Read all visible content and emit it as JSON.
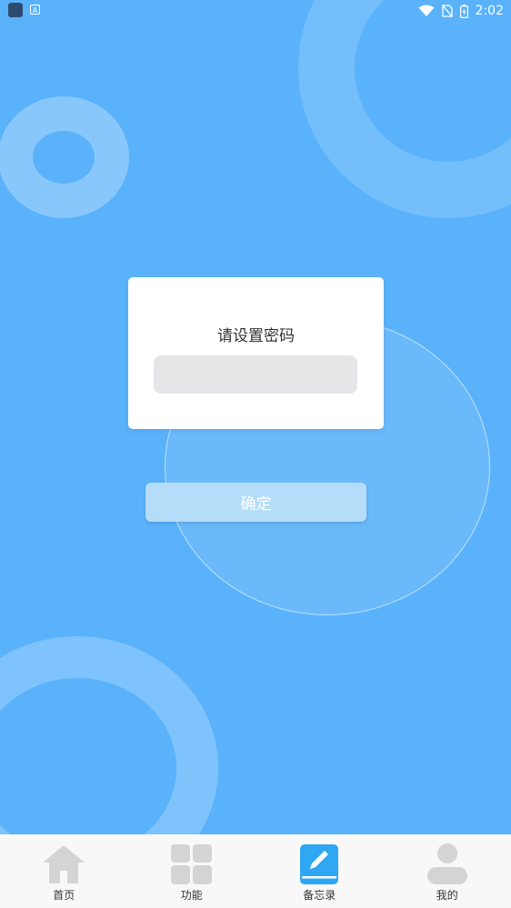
{
  "status_bar": {
    "time": "2:02",
    "icons": [
      "app-icon",
      "a-icon",
      "wifi-icon",
      "no-sim-icon",
      "battery-icon"
    ]
  },
  "dialog": {
    "title": "请设置密码",
    "password_value": "",
    "password_placeholder": ""
  },
  "confirm_button": {
    "label": "确定"
  },
  "bottom_nav": {
    "items": [
      {
        "label": "首页",
        "icon": "home-icon",
        "active": false
      },
      {
        "label": "功能",
        "icon": "grid-icon",
        "active": false
      },
      {
        "label": "备忘录",
        "icon": "memo-pencil-icon",
        "active": true
      },
      {
        "label": "我的",
        "icon": "person-icon",
        "active": false
      }
    ]
  },
  "colors": {
    "background": "#5AB2FB",
    "accent": "#2FA7F3",
    "nav_inactive": "#D4D4D4",
    "button": "#B5DDF9"
  }
}
